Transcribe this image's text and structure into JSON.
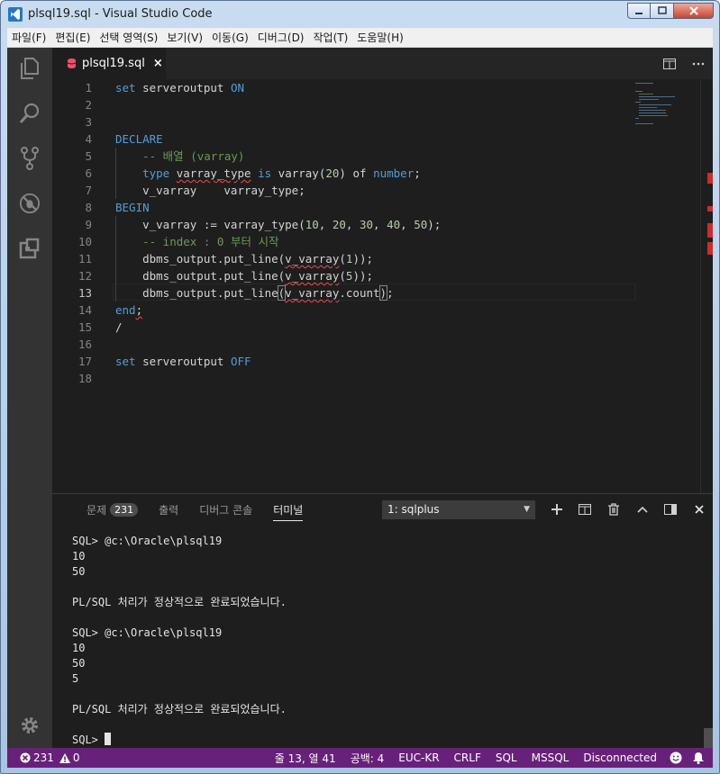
{
  "window": {
    "title": "plsql19.sql - Visual Studio Code"
  },
  "menu": [
    "파일(F)",
    "편집(E)",
    "선택 영역(S)",
    "보기(V)",
    "이동(G)",
    "디버그(D)",
    "작업(T)",
    "도움말(H)"
  ],
  "tab": {
    "label": "plsql19.sql",
    "close": "×"
  },
  "editor": {
    "current_line": 13,
    "line_numbers": [
      "1",
      "2",
      "3",
      "4",
      "5",
      "6",
      "7",
      "8",
      "9",
      "10",
      "11",
      "12",
      "13",
      "14",
      "15",
      "16",
      "17",
      "18"
    ]
  },
  "panel": {
    "tabs": [
      {
        "label": "문제",
        "badge": "231"
      },
      {
        "label": "출력"
      },
      {
        "label": "디버그 콘솔"
      },
      {
        "label": "터미널",
        "active": true
      }
    ],
    "terminal_select": "1: sqlplus",
    "terminal_lines": [
      "SQL> @c:\\Oracle\\plsql19",
      "10",
      "50",
      "",
      "PL/SQL 처리가 정상적으로 완료되었습니다.",
      "",
      "SQL> @c:\\Oracle\\plsql19",
      "10",
      "50",
      "5",
      "",
      "PL/SQL 처리가 정상적으로 완료되었습니다.",
      "",
      "SQL> "
    ]
  },
  "status": {
    "errors": "231",
    "warnings": "0",
    "position": "줄 13, 열 41",
    "spaces": "공백: 4",
    "encoding": "EUC-KR",
    "eol": "CRLF",
    "language": "SQL",
    "connection_type": "MSSQL",
    "connection_state": "Disconnected"
  },
  "colors": {
    "statusbar": "#68217a",
    "keyword": "#569cd6",
    "comment": "#6a9955",
    "number": "#b5cea8",
    "error": "#f14c4c"
  },
  "icons": [
    "explorer-icon",
    "search-icon",
    "source-control-icon",
    "debug-icon",
    "extensions-icon",
    "settings-gear-icon"
  ]
}
